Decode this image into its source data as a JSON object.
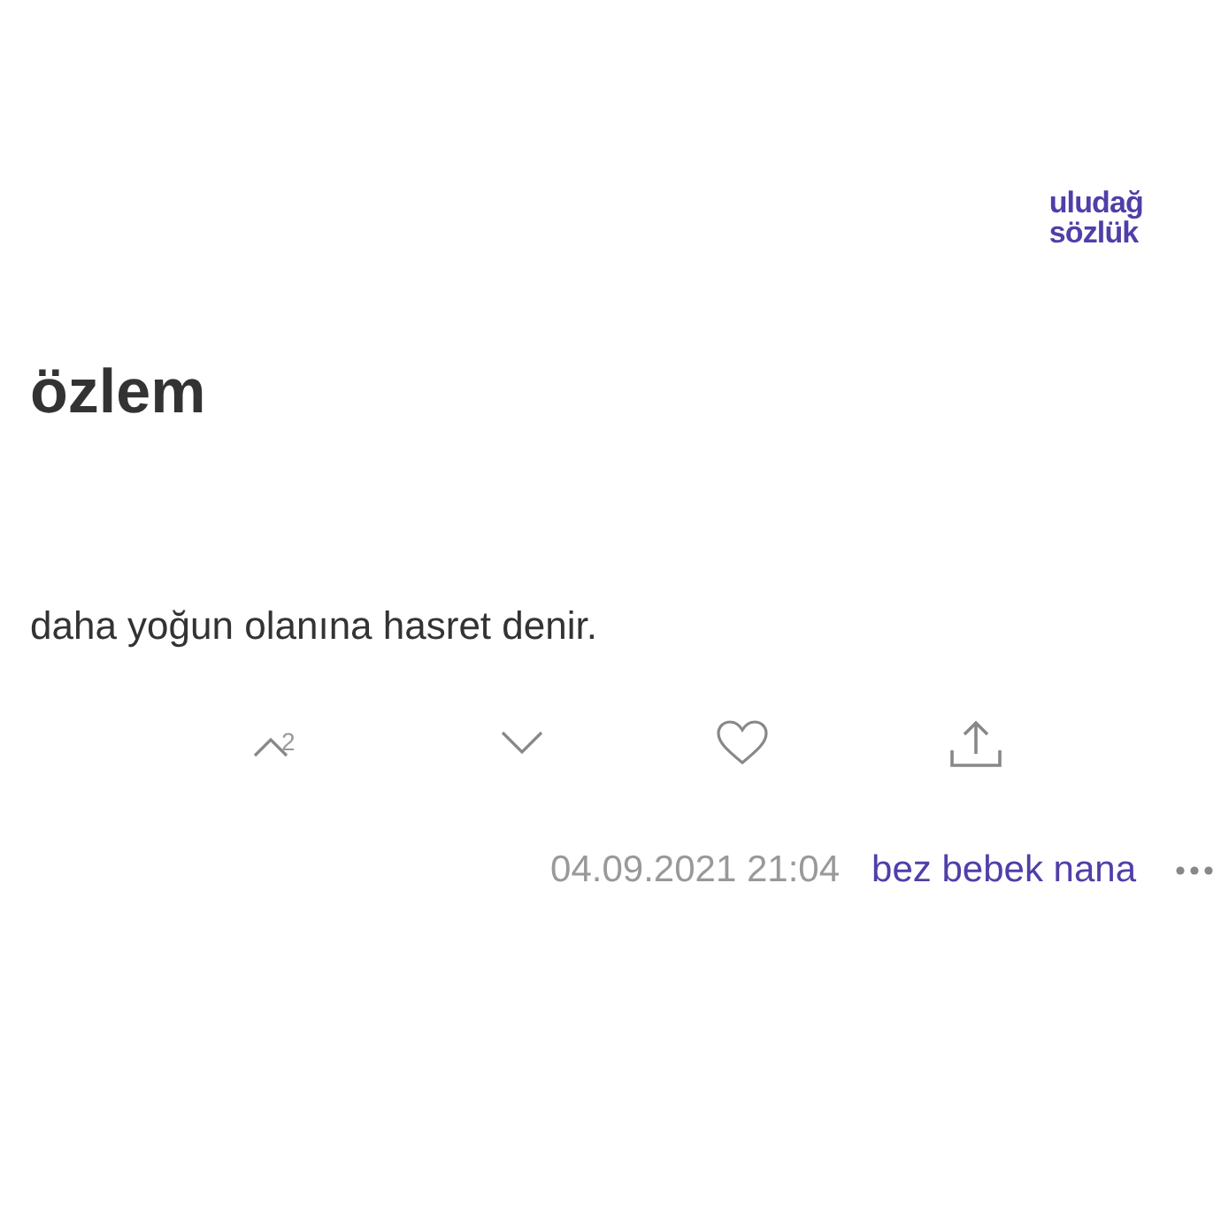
{
  "logo": {
    "lines": [
      "uludağ",
      "sözlük"
    ]
  },
  "title": "özlem",
  "entry": {
    "text": "daha yoğun olanına hasret denir.",
    "actions": [
      {
        "kind": "upvote",
        "count": "2"
      },
      {
        "kind": "downvote"
      },
      {
        "kind": "favorite"
      },
      {
        "kind": "share"
      }
    ],
    "date": "04.09.2021 21:04",
    "author": "bez bebek nana"
  }
}
